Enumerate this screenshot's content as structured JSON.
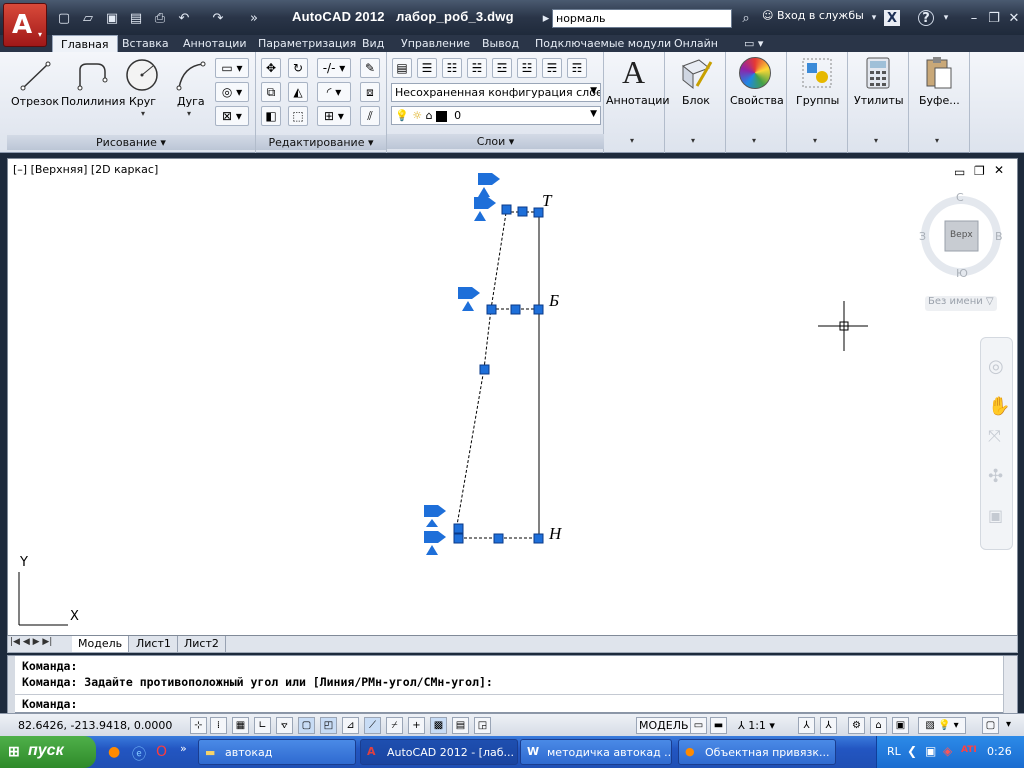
{
  "title_bar": {
    "app_title": "AutoCAD 2012",
    "file_name": "лабор_роб_3.dwg",
    "search_value": "нормаль",
    "sign_in": "Вход в службы",
    "help": "?"
  },
  "ribbon_tabs": [
    "Главная",
    "Вставка",
    "Аннотации",
    "Параметризация",
    "Вид",
    "Управление",
    "Вывод",
    "Подключаемые модули",
    "Онлайн"
  ],
  "draw_panel": {
    "tools": [
      "Отрезок",
      "Полилиния",
      "Круг",
      "Дуга"
    ],
    "footer": "Рисование ▾"
  },
  "modify_panel": {
    "footer": "Редактирование ▾"
  },
  "layers_panel": {
    "layer_state": "Несохраненная конфигурация слоев",
    "current_layer": "0",
    "footer": "Слои"
  },
  "big_tools": [
    "Аннотации",
    "Блок",
    "Свойства",
    "Группы",
    "Утилиты",
    "Буфе..."
  ],
  "viewport": {
    "label": "[–] [Верхняя] [2D каркас]",
    "viewcube": {
      "top": "С",
      "left": "З",
      "right": "В",
      "bottom": "Ю",
      "face": "Верх"
    },
    "ucs_name": "Без имени",
    "point_labels": [
      "Т",
      "Б",
      "Н"
    ],
    "ucs_x": "X",
    "ucs_y": "Y"
  },
  "layout_tabs": [
    "Модель",
    "Лист1",
    "Лист2"
  ],
  "command_lines": [
    "Команда:",
    "Команда: Задайте противоположный угол или [Линия/РМн-угол/СМн-угол]:",
    "Команда:"
  ],
  "status": {
    "coords": "82.6426,  -213.9418, 0.0000",
    "model": "МОДЕЛЬ",
    "scale": "1:1"
  },
  "taskbar": {
    "start": "пуск",
    "tasks": [
      "автокад",
      "AutoCAD 2012 - [лаб...",
      "методичка автокад ...",
      "Объектная привязк..."
    ],
    "lang": "RL",
    "clock": "0:26"
  },
  "colors": {
    "grip": "#1e6fd9",
    "accent": "#a01818"
  }
}
